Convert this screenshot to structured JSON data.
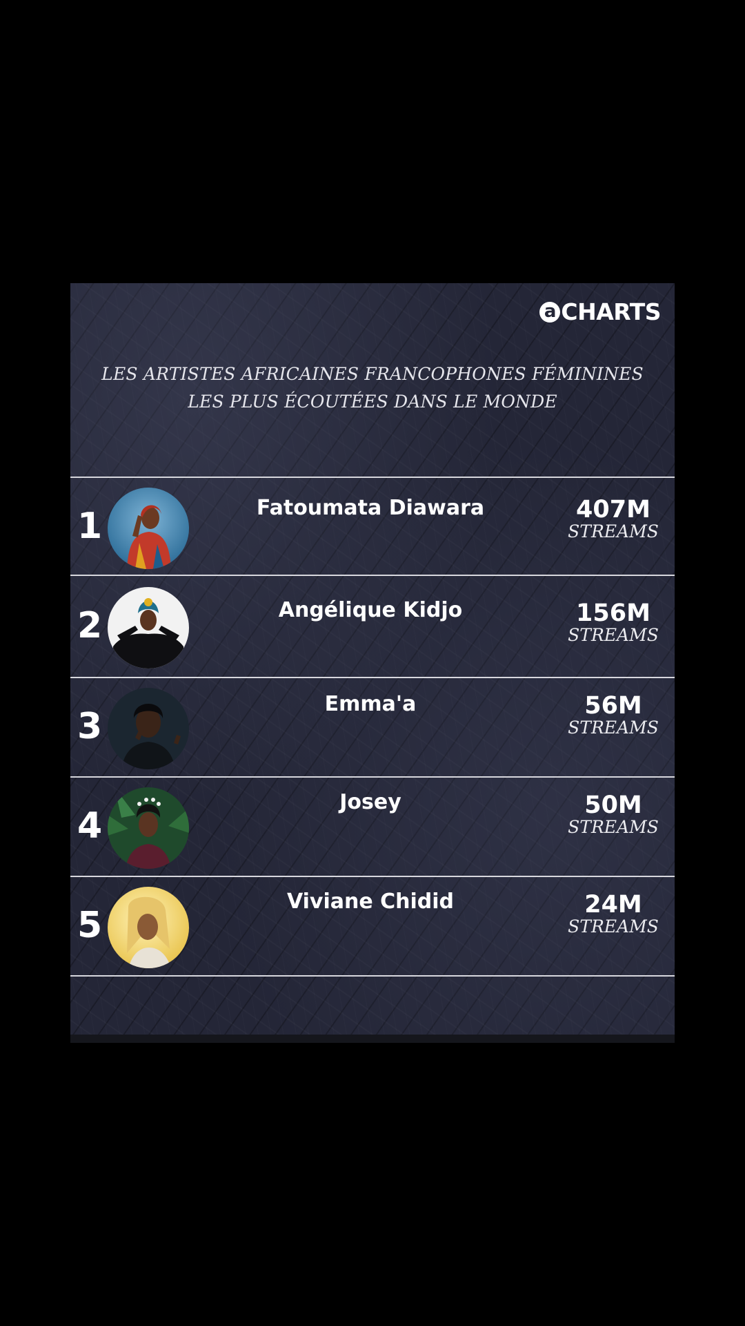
{
  "brand": {
    "logo_letter": "a",
    "logo_text": "CHARTS"
  },
  "headline": {
    "line1": "LES ARTISTES AFRICAINES FRANCOPHONES FÉMININES",
    "line2": "LES PLUS ÉCOUTÉES DANS LE MONDE"
  },
  "ranking": [
    {
      "rank": "1",
      "name": "Fatoumata Diawara",
      "streams": "407M",
      "unit": "STREAMS"
    },
    {
      "rank": "2",
      "name": "Angélique Kidjo",
      "streams": "156M",
      "unit": "STREAMS"
    },
    {
      "rank": "3",
      "name": "Emma'a",
      "streams": "56M",
      "unit": "STREAMS"
    },
    {
      "rank": "4",
      "name": "Josey",
      "streams": "50M",
      "unit": "STREAMS"
    },
    {
      "rank": "5",
      "name": "Viviane Chidid",
      "streams": "24M",
      "unit": "STREAMS"
    }
  ],
  "colors": {
    "page_background": "#000000",
    "card_background": "#242637",
    "text": "#ffffff",
    "divider": "#d8d8de"
  },
  "icons": {
    "avatars": [
      "artist-photo-icon",
      "artist-photo-icon",
      "artist-photo-icon",
      "artist-photo-icon",
      "artist-photo-icon"
    ]
  }
}
